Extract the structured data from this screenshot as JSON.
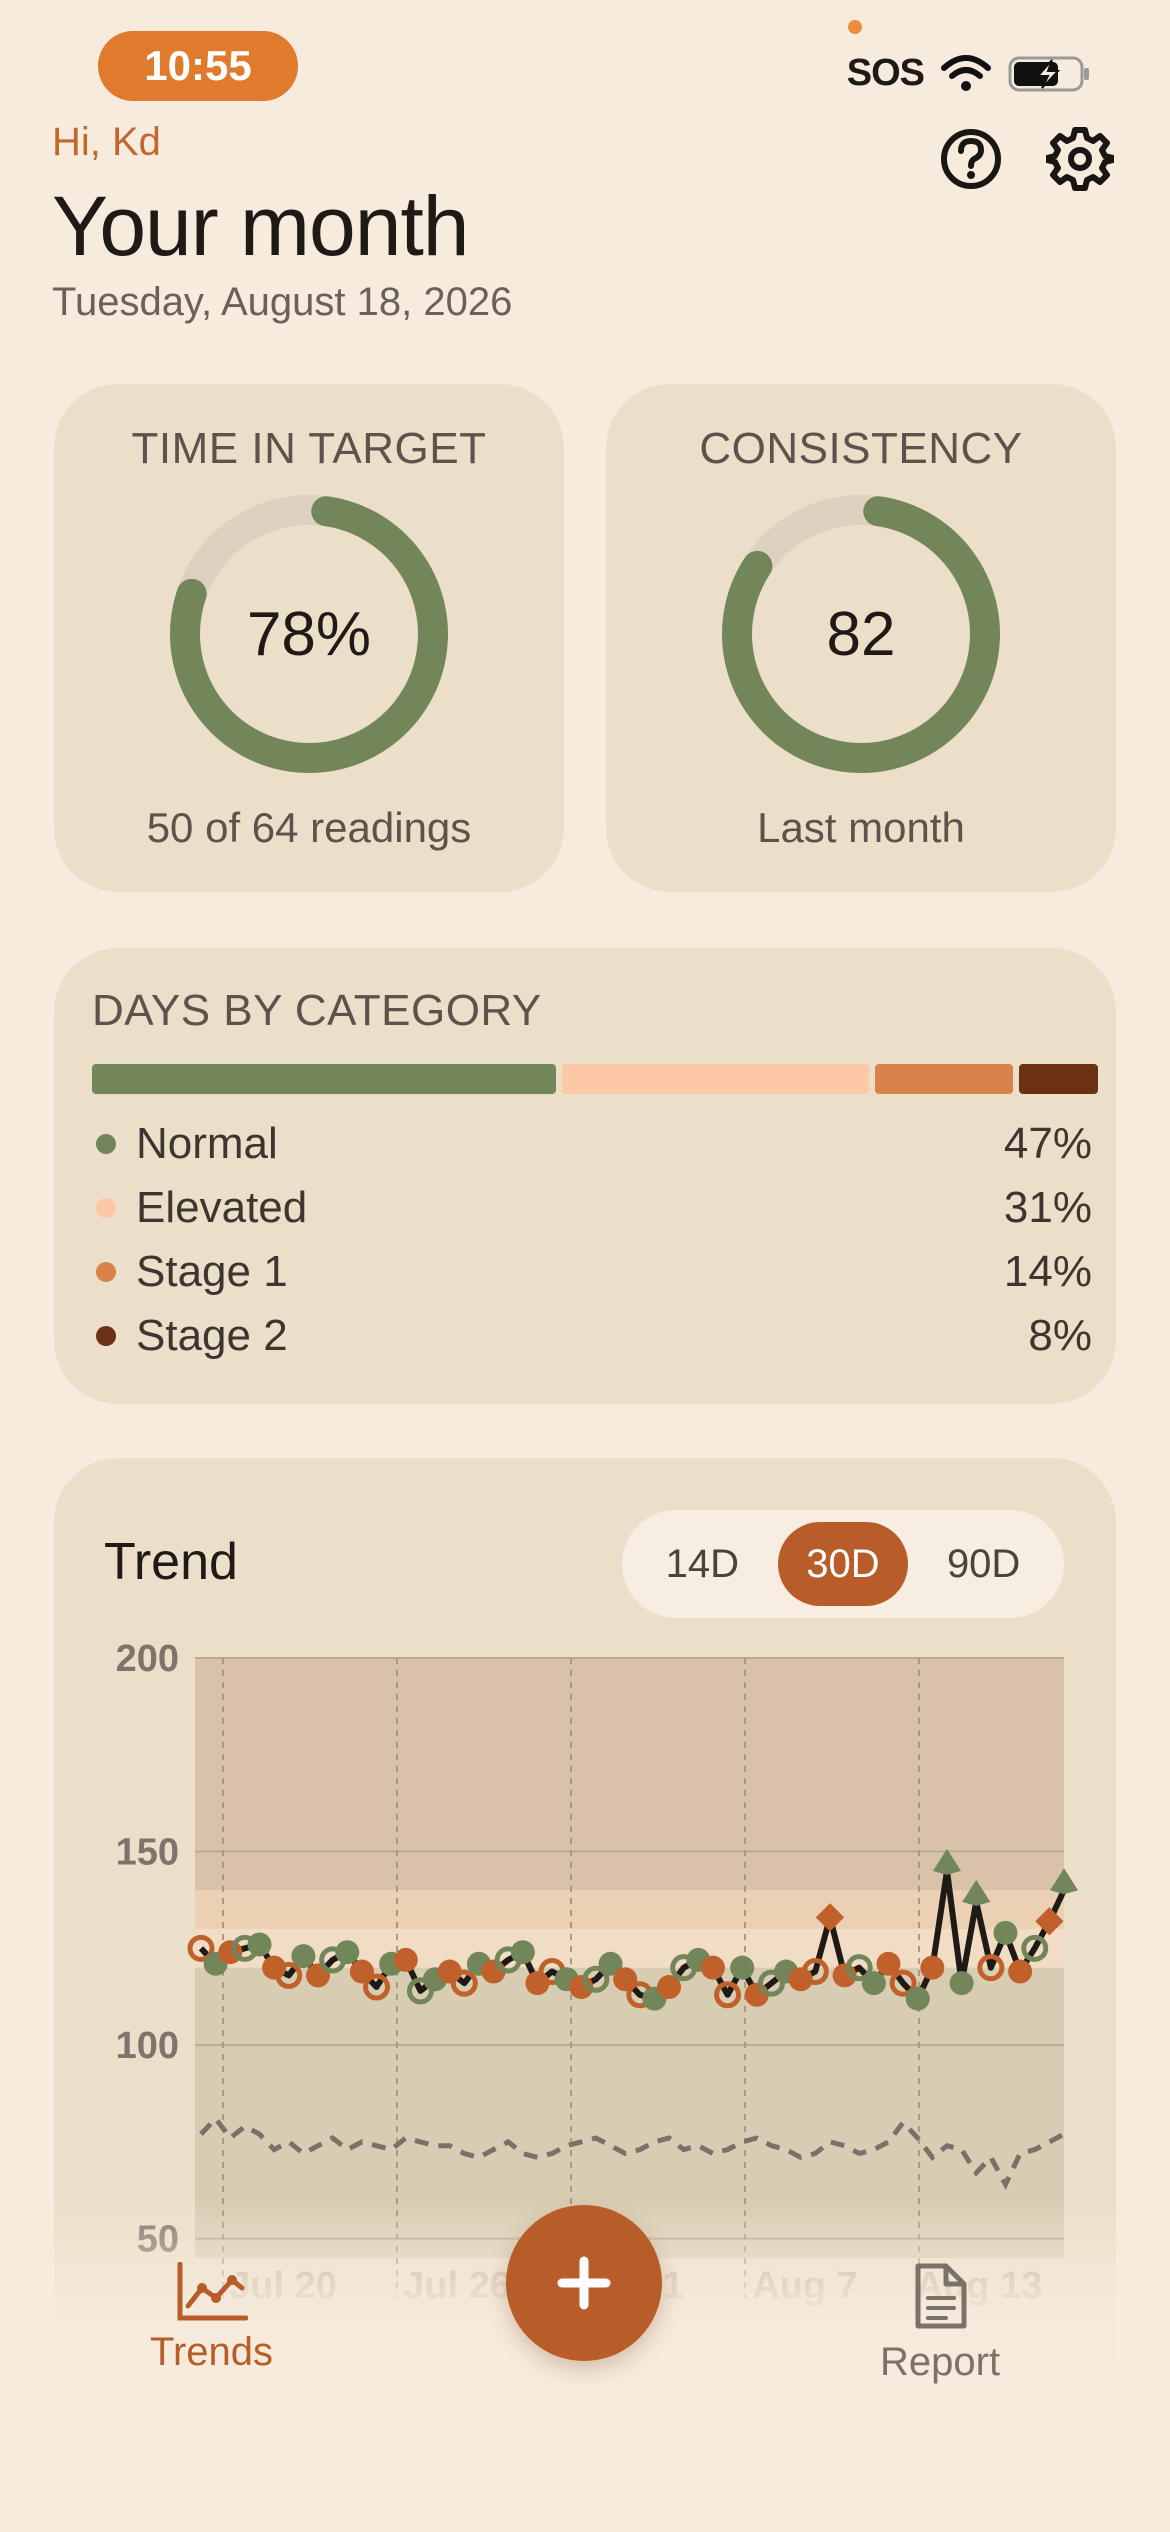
{
  "status": {
    "time": "10:55",
    "sos": "SOS"
  },
  "header": {
    "greeting": "Hi, Kd",
    "title": "Your month",
    "date": "Tuesday, August 18, 2026"
  },
  "stats": [
    {
      "label": "TIME IN TARGET",
      "value": "78%",
      "fraction": 0.78,
      "sub": "50 of 64 readings"
    },
    {
      "label": "CONSISTENCY",
      "value": "82",
      "fraction": 0.82,
      "sub": "Last month"
    }
  ],
  "categories": {
    "title": "DAYS BY CATEGORY",
    "items": [
      {
        "name": "Normal",
        "pct": "47%",
        "share": 47,
        "color": "#738659"
      },
      {
        "name": "Elevated",
        "pct": "31%",
        "share": 31,
        "color": "#fcc8a6"
      },
      {
        "name": "Stage 1",
        "pct": "14%",
        "share": 14,
        "color": "#d9824a"
      },
      {
        "name": "Stage 2",
        "pct": "8%",
        "share": 8,
        "color": "#6a3212"
      }
    ]
  },
  "trend": {
    "title": "Trend",
    "ranges": [
      "14D",
      "30D",
      "90D"
    ],
    "active_range": "30D"
  },
  "chart_data": {
    "type": "line",
    "ylim": [
      45,
      200
    ],
    "y_ticks": [
      "200",
      "150",
      "100",
      "50"
    ],
    "x_ticks": [
      "Jul 20",
      "Jul 26",
      "Aug 1",
      "Aug 7",
      "Aug 13"
    ],
    "zones": [
      {
        "name": "Stage 2",
        "from": 140,
        "to": 200,
        "color": "#d8c2a9"
      },
      {
        "name": "Stage 1",
        "from": 130,
        "to": 140,
        "color": "#ecd0b4"
      },
      {
        "name": "Elevated",
        "from": 120,
        "to": 130,
        "color": "#f1ddc5"
      },
      {
        "name": "Normal",
        "from": 45,
        "to": 120,
        "color": "#d8cdb3"
      }
    ],
    "series": [
      {
        "values": [
          125,
          121,
          124,
          125,
          126,
          120,
          118,
          123,
          118,
          122,
          124,
          119,
          115,
          121,
          122,
          114,
          117,
          119,
          116,
          121,
          119,
          122,
          124,
          116,
          119,
          117,
          115,
          117,
          121,
          117,
          113,
          112,
          115,
          120,
          122,
          120,
          113,
          120,
          113,
          116,
          119,
          117,
          119,
          133,
          118,
          120,
          116,
          121,
          116,
          112,
          120,
          145,
          116,
          137,
          120,
          129,
          119,
          125,
          132,
          140
        ]
      },
      {
        "values": [
          77,
          81,
          76,
          79,
          77,
          73,
          75,
          72,
          74,
          76,
          73,
          75,
          74,
          73,
          76,
          75,
          74,
          74,
          72,
          71,
          73,
          75,
          72,
          71,
          72,
          74,
          75,
          76,
          74,
          72,
          73,
          75,
          76,
          73,
          74,
          72,
          73,
          75,
          76,
          74,
          73,
          71,
          72,
          75,
          74,
          72,
          73,
          75,
          80,
          76,
          71,
          74,
          73,
          67,
          71,
          64,
          72,
          73,
          75,
          77
        ]
      }
    ]
  },
  "nav": {
    "trends": "Trends",
    "report": "Report",
    "add": "+"
  }
}
